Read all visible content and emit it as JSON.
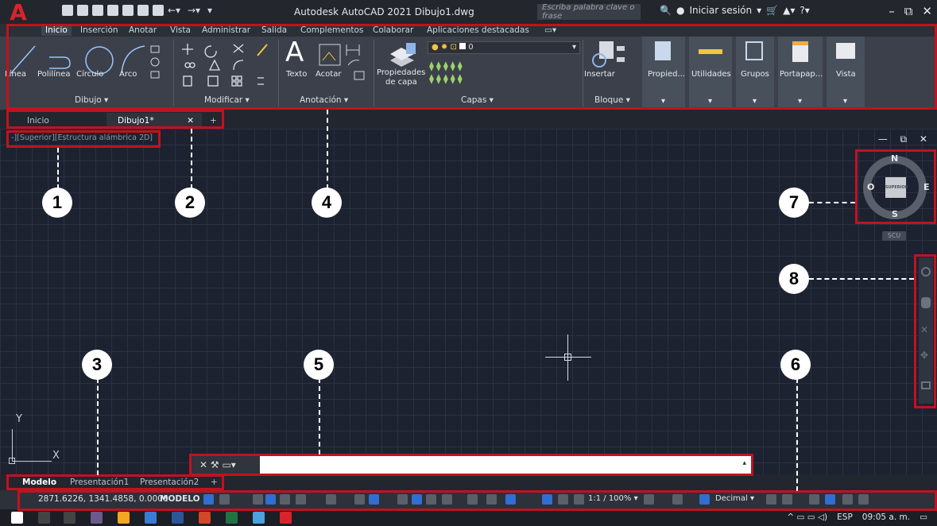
{
  "title_bar": {
    "window_title": "Autodesk AutoCAD 2021   Dibujo1.dwg",
    "search_placeholder": "Escriba palabra clave o frase",
    "sign_in": "Iniciar sesión"
  },
  "ribbon": {
    "tabs": [
      "Inicio",
      "Inserción",
      "Anotar",
      "Vista",
      "Administrar",
      "Salida",
      "Complementos",
      "Colaborar",
      "Aplicaciones destacadas"
    ],
    "active_tab": "Inicio",
    "draw": {
      "linea": "Línea",
      "polilinea": "Polilínea",
      "circulo": "Círculo",
      "arco": "Arco",
      "label": "Dibujo ▾"
    },
    "modify": {
      "label": "Modificar ▾"
    },
    "annotation": {
      "texto": "Texto",
      "acotar": "Acotar",
      "label": "Anotación ▾"
    },
    "layers": {
      "propiedades": "Propiedades",
      "de_capa": "de capa",
      "layer_value": "0",
      "label": "Capas ▾"
    },
    "block": {
      "insertar": "Insertar",
      "label": "Bloque ▾"
    },
    "extra": [
      "Propied...",
      "Utilidades",
      "Grupos",
      "Portapap...",
      "Vista"
    ]
  },
  "file_tabs": {
    "home": "Inicio",
    "active": "Dibujo1*",
    "close": "✕",
    "add": "+"
  },
  "viewport": {
    "label": "-][Superior][Estructura alámbrica 2D]",
    "controls": "— ⧉ ✕"
  },
  "viewcube": {
    "north": "N",
    "south": "S",
    "east": "E",
    "west": "O",
    "face": "SUPERIOR",
    "wcs": "SCU"
  },
  "ucs": {
    "x": "X",
    "y": "Y"
  },
  "callouts": [
    "1",
    "2",
    "3",
    "4",
    "5",
    "6",
    "7",
    "8"
  ],
  "command_line": {
    "icons": "✕ ⚒ ▭▾",
    "value": ""
  },
  "layout_tabs": {
    "model": "Modelo",
    "layout1": "Presentación1",
    "layout2": "Presentación2",
    "add": "+"
  },
  "status_bar": {
    "coordinates": "2871.6226, 1341.4858, 0.0000",
    "mode": "MODELO",
    "scale": "1:1 / 100% ▾",
    "units": "Decimal ▾"
  },
  "taskbar": {
    "language": "ESP",
    "time": "09:05 a. m."
  },
  "colors": {
    "annotation_red": "#c1121f",
    "autocad_red": "#d8242d",
    "ribbon_bg": "#3b404a",
    "canvas_bg": "#1c2230"
  }
}
